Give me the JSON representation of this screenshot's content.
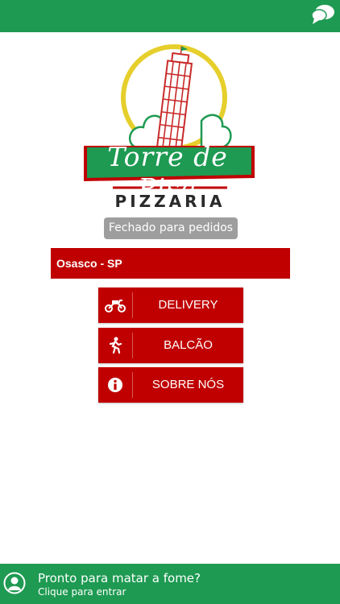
{
  "logo": {
    "title": "Torre de Pisa",
    "subtitle": "PIZZARIA"
  },
  "status": {
    "text": "Fechado para pedidos"
  },
  "location": {
    "label": "Osasco - SP"
  },
  "menu": {
    "delivery": {
      "label": "DELIVERY",
      "icon": "motorcycle-icon"
    },
    "balcao": {
      "label": "BALCÃO",
      "icon": "walking-person-icon"
    },
    "sobre": {
      "label": "SOBRE NÓS",
      "icon": "info-icon"
    }
  },
  "footer": {
    "title": "Pronto para matar a fome?",
    "subtitle": "Clique para entrar"
  },
  "colors": {
    "brand_green": "#1e9a52",
    "brand_red": "#c00000",
    "status_gray": "#9e9e9e"
  }
}
